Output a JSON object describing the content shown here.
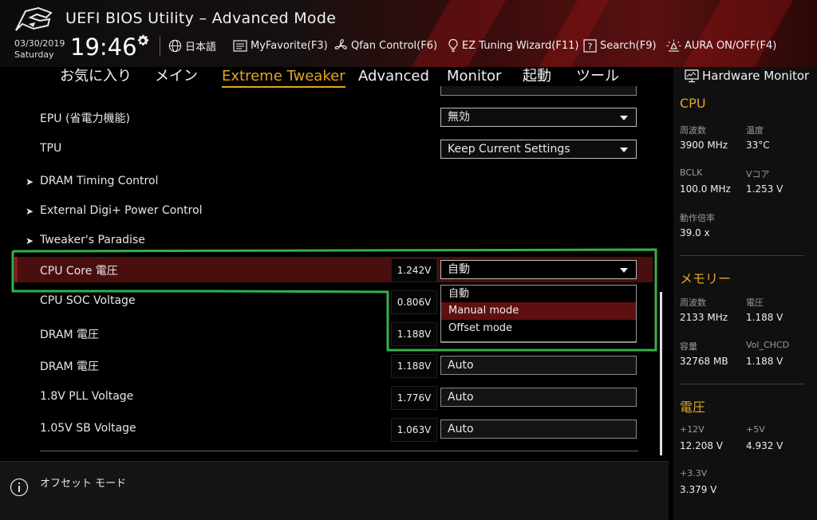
{
  "header": {
    "title": "UEFI BIOS Utility – Advanced Mode",
    "date": "03/30/2019",
    "weekday": "Saturday",
    "time": "19:46",
    "tools": [
      {
        "label": "日本語",
        "icon": "globe-icon"
      },
      {
        "label": "MyFavorite(F3)",
        "icon": "favorite-list-icon"
      },
      {
        "label": "Qfan Control(F6)",
        "icon": "fan-icon"
      },
      {
        "label": "EZ Tuning Wizard(F11)",
        "icon": "bulb-icon"
      },
      {
        "label": "Search(F9)",
        "icon": "search-help-icon"
      },
      {
        "label": "AURA ON/OFF(F4)",
        "icon": "aura-light-icon"
      }
    ]
  },
  "tabs": [
    "お気に入り",
    "メイン",
    "Extreme Tweaker",
    "Advanced",
    "Monitor",
    "起動",
    "ツール"
  ],
  "active_tab": "Extreme Tweaker",
  "settings": {
    "epu": {
      "label": "EPU (省電力機能)",
      "value": "無効"
    },
    "tpu": {
      "label": "TPU",
      "value": "Keep Current Settings"
    },
    "submenus": [
      "DRAM Timing Control",
      "External Digi+ Power Control",
      "Tweaker's Paradise"
    ],
    "cpu_core": {
      "label": "CPU Core 電圧",
      "reading": "1.242V",
      "value": "自動"
    },
    "cpu_soc": {
      "label": "CPU SOC Voltage",
      "reading": "0.806V"
    },
    "dram1": {
      "label": "DRAM 電圧",
      "reading": "1.188V"
    },
    "dram2": {
      "label": "DRAM 電圧",
      "reading": "1.188V",
      "value": "Auto"
    },
    "pll": {
      "label": "1.8V PLL Voltage",
      "reading": "1.776V",
      "value": "Auto"
    },
    "sb": {
      "label": "1.05V SB Voltage",
      "reading": "1.063V",
      "value": "Auto"
    }
  },
  "dropdown": {
    "options": [
      "自動",
      "Manual mode",
      "Offset mode"
    ],
    "highlighted": "Manual mode"
  },
  "help": {
    "text": "オフセット モード"
  },
  "hardware_monitor": {
    "title": "Hardware Monitor",
    "cpu": {
      "heading": "CPU",
      "freq_label": "周波数",
      "freq_value": "3900 MHz",
      "temp_label": "温度",
      "temp_value": "33°C",
      "bclk_label": "BCLK",
      "bclk_value": "100.0 MHz",
      "vcore_label": "Vコア",
      "vcore_value": "1.253 V",
      "ratio_label": "動作倍率",
      "ratio_value": "39.0 x"
    },
    "memory": {
      "heading": "メモリー",
      "freq_label": "周波数",
      "freq_value": "2133 MHz",
      "volt_label": "電圧",
      "volt_value": "1.188 V",
      "cap_label": "容量",
      "cap_value": "32768 MB",
      "chcd_label": "Vol_CHCD",
      "chcd_value": "1.188 V"
    },
    "voltage": {
      "heading": "電圧",
      "v12_label": "+12V",
      "v12_value": "12.208 V",
      "v5_label": "+5V",
      "v5_value": "4.932 V",
      "v33_label": "+3.3V",
      "v33_value": "3.379 V"
    }
  },
  "colors": {
    "accent": "#e5a425",
    "selection": "#4a0e0e",
    "highlight_box": "#35b04a"
  }
}
